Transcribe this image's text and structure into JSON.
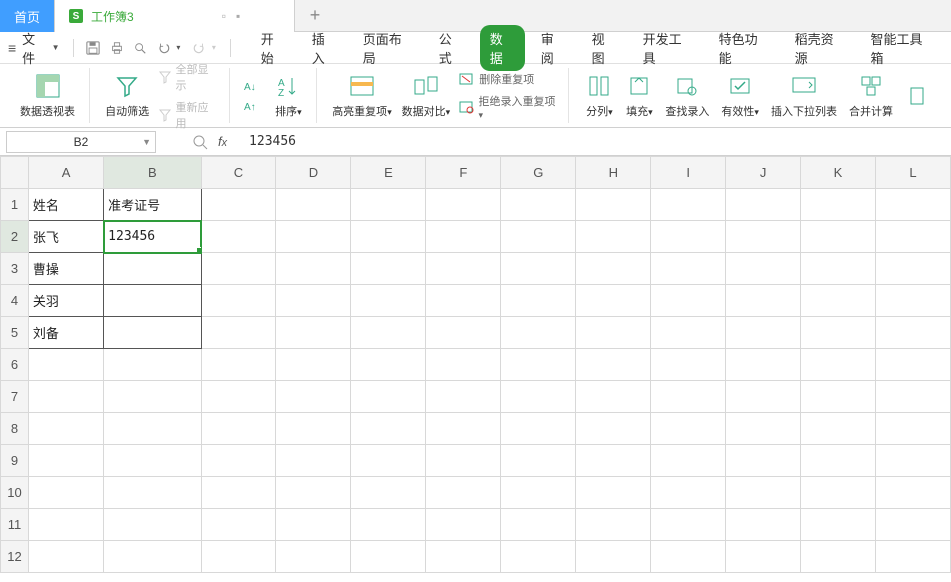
{
  "tabs": {
    "home": "首页",
    "doc_name": "工作簿3",
    "doc_icon": "S"
  },
  "menu": {
    "file": "文件",
    "items": [
      "开始",
      "插入",
      "页面布局",
      "公式",
      "数据",
      "审阅",
      "视图",
      "开发工具",
      "特色功能",
      "稻壳资源",
      "智能工具箱"
    ],
    "active_index": 4
  },
  "ribbon": {
    "pivot": "数据透视表",
    "autofilter": "自动筛选",
    "show_all": "全部显示",
    "reapply": "重新应用",
    "sort": "排序",
    "highlight_dup": "高亮重复项",
    "data_compare": "数据对比",
    "remove_dup": "删除重复项",
    "reject_dup": "拒绝录入重复项",
    "text_to_cols": "分列",
    "fill": "填充",
    "lookup_entry": "查找录入",
    "validation": "有效性",
    "insert_dropdown": "插入下拉列表",
    "consolidate": "合并计算"
  },
  "name_box": "B2",
  "formula_value": "123456",
  "columns": [
    "A",
    "B",
    "C",
    "D",
    "E",
    "F",
    "G",
    "H",
    "I",
    "J",
    "K",
    "L"
  ],
  "rows_visible": 12,
  "selected": {
    "row": 2,
    "col": "B"
  },
  "cells": {
    "A1": "姓名",
    "B1": "准考证号",
    "A2": "张飞",
    "B2": "123456",
    "A3": "曹操",
    "A4": "关羽",
    "A5": "刘备"
  },
  "data_range": {
    "rows": 5,
    "cols": 2
  }
}
